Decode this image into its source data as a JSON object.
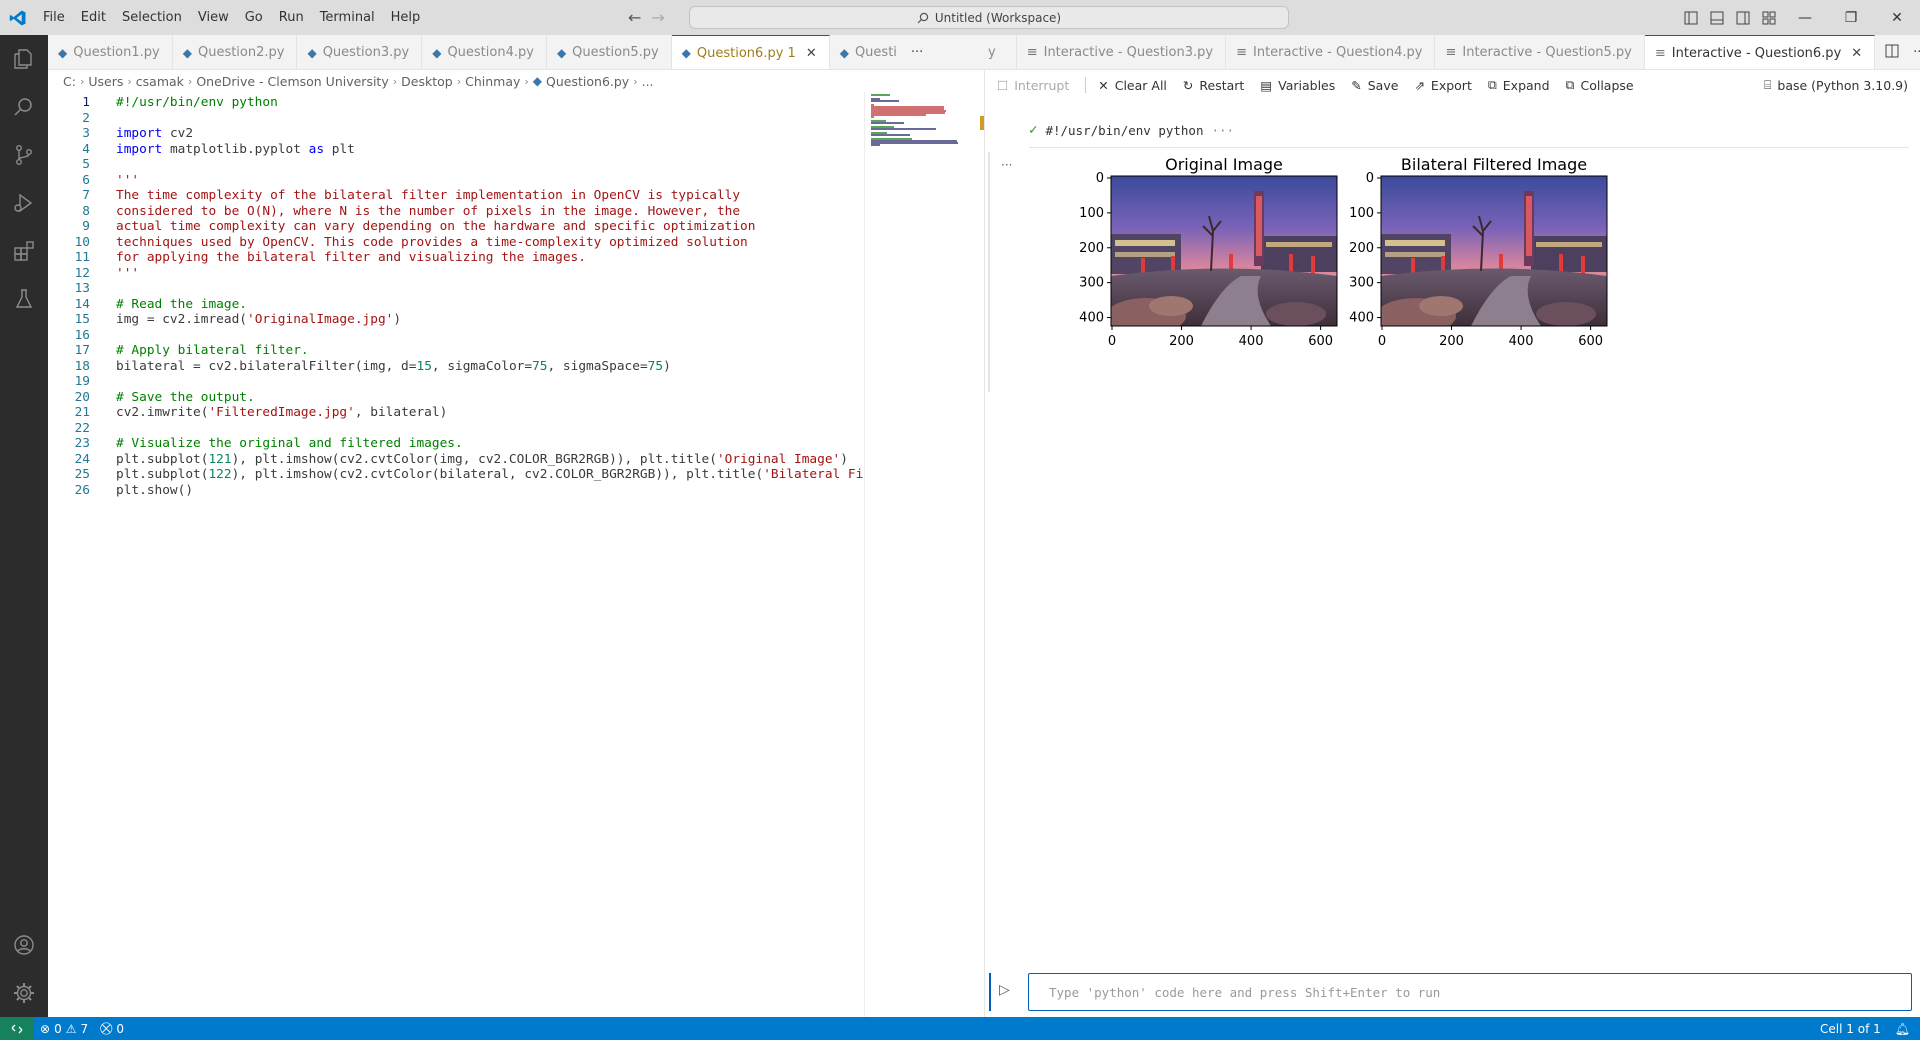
{
  "menu": [
    "File",
    "Edit",
    "Selection",
    "View",
    "Go",
    "Run",
    "Terminal",
    "Help"
  ],
  "command_center": "Untitled (Workspace)",
  "editor_tabs": [
    {
      "label": "Question1.py",
      "active": false
    },
    {
      "label": "Question2.py",
      "active": false
    },
    {
      "label": "Question3.py",
      "active": false
    },
    {
      "label": "Question4.py",
      "active": false
    },
    {
      "label": "Question5.py",
      "active": false
    },
    {
      "label": "Question6.py 1",
      "active": true
    },
    {
      "label": "Questi",
      "active": false
    }
  ],
  "iw_tabs": [
    {
      "label": "y",
      "active": false
    },
    {
      "label": "Interactive - Question3.py",
      "active": false
    },
    {
      "label": "Interactive - Question4.py",
      "active": false
    },
    {
      "label": "Interactive - Question5.py",
      "active": false
    },
    {
      "label": "Interactive - Question6.py",
      "active": true
    }
  ],
  "breadcrumb": [
    "C:",
    "Users",
    "csamak",
    "OneDrive - Clemson University",
    "Desktop",
    "Chinmay",
    "Question6.py",
    "..."
  ],
  "code_lines": [
    "#!/usr/bin/env python",
    "",
    "import cv2",
    "import matplotlib.pyplot as plt",
    "",
    "'''",
    "The time complexity of the bilateral filter implementation in OpenCV is typically",
    "considered to be O(N), where N is the number of pixels in the image. However, the",
    "actual time complexity can vary depending on the hardware and specific optimization",
    "techniques used by OpenCV. This code provides a time-complexity optimized solution",
    "for applying the bilateral filter and visualizing the images.",
    "'''",
    "",
    "# Read the image.",
    "img = cv2.imread('OriginalImage.jpg')",
    "",
    "# Apply bilateral filter.",
    "bilateral = cv2.bilateralFilter(img, d=15, sigmaColor=75, sigmaSpace=75)",
    "",
    "# Save the output.",
    "cv2.imwrite('FilteredImage.jpg', bilateral)",
    "",
    "# Visualize the original and filtered images.",
    "plt.subplot(121), plt.imshow(cv2.cvtColor(img, cv2.COLOR_BGR2RGB)), plt.title('Original Image')",
    "plt.subplot(122), plt.imshow(cv2.cvtColor(bilateral, cv2.COLOR_BGR2RGB)), plt.title('Bilateral Fi",
    "plt.show()"
  ],
  "iw_toolbar": {
    "interrupt": "Interrupt",
    "clear_all": "Clear All",
    "restart": "Restart",
    "variables": "Variables",
    "save": "Save",
    "export": "Export",
    "expand": "Expand",
    "collapse": "Collapse",
    "kernel": "base (Python 3.10.9)"
  },
  "cell_header": "#!/usr/bin/env python",
  "cell_header_more": "···",
  "output_dots": "···",
  "plots": [
    {
      "title": "Original Image"
    },
    {
      "title": "Bilateral Filtered Image"
    }
  ],
  "plot_axes": {
    "yticks": [
      "0",
      "100",
      "200",
      "300",
      "400"
    ],
    "xticks": [
      "0",
      "200",
      "400",
      "600"
    ]
  },
  "input_placeholder": "Type 'python' code here and press Shift+Enter to run",
  "status": {
    "errors": "0",
    "warnings": "7",
    "ports": "0",
    "cell": "Cell 1 of 1"
  },
  "colors": {
    "accent": "#007acc",
    "activity_bar": "#2c2c2c",
    "titlebar": "#dddddd"
  }
}
